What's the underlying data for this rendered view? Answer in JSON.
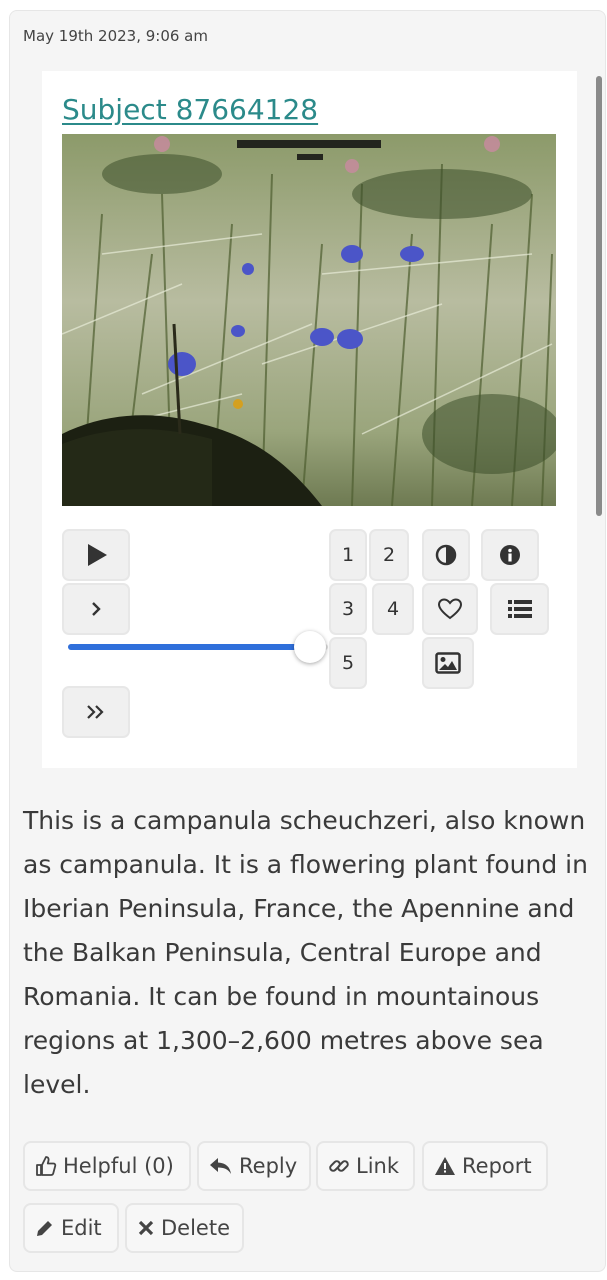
{
  "comment": {
    "timestamp": "May 19th 2023, 9:06 am",
    "subject_link": "Subject 87664128",
    "image": {
      "alt": "Camera trap photo of blue bellflowers in grass",
      "overlay_text": "XXXX XX XXXXXXX XXXXXXXX"
    },
    "body": "This is a campanula scheuchzeri, also known as campanula. It is a flowering plant found in Iberian Peninsula, France, the Apennine and the Balkan Peninsula, Central Europe and Romania. It can be found in mountainous regions at 1,300–2,600 metres above sea level."
  },
  "player": {
    "play_icon": "play-icon",
    "step_icon": "chevron-right-icon",
    "fast_icon": "double-chevron-right-icon",
    "frames": [
      "1",
      "2",
      "3",
      "4",
      "5"
    ],
    "slider_value": 0.93,
    "accent": "#2f6fdb"
  },
  "tools": {
    "invert_icon": "contrast-icon",
    "info_icon": "info-icon",
    "favorite_icon": "heart-icon",
    "collections_icon": "list-icon",
    "image_icon": "image-icon"
  },
  "actions": {
    "helpful": "Helpful (0)",
    "reply": "Reply",
    "link": "Link",
    "report": "Report",
    "edit": "Edit",
    "delete": "Delete"
  },
  "colors": {
    "link": "#2b8a8a",
    "card_bg": "#f5f5f5"
  }
}
